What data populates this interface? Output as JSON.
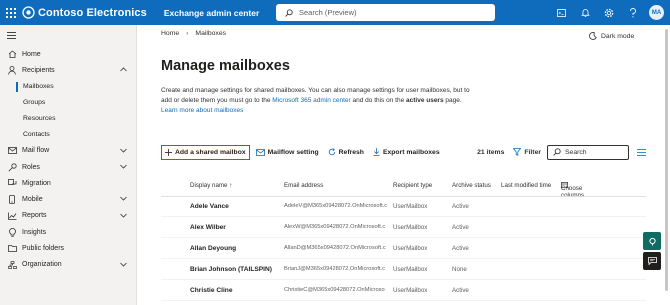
{
  "topbar": {
    "brand": "Contoso Electronics",
    "app_name": "Exchange admin center",
    "search_placeholder": "Search (Preview)",
    "user_initials": "MA",
    "icons": [
      "waffle-icon",
      "terminal-icon",
      "notifications-icon",
      "settings-icon",
      "help-icon"
    ],
    "color": "#0f6cbd"
  },
  "sidebar": {
    "items": [
      {
        "label": "Home",
        "icon": "home-icon"
      },
      {
        "label": "Recipients",
        "icon": "person-icon",
        "expanded": true,
        "children": [
          {
            "label": "Mailboxes",
            "active": true
          },
          {
            "label": "Groups"
          },
          {
            "label": "Resources"
          },
          {
            "label": "Contacts"
          }
        ]
      },
      {
        "label": "Mail flow",
        "icon": "mail-icon"
      },
      {
        "label": "Roles",
        "icon": "key-icon"
      },
      {
        "label": "Migration",
        "icon": "migration-icon"
      },
      {
        "label": "Mobile",
        "icon": "mobile-icon"
      },
      {
        "label": "Reports",
        "icon": "chart-icon"
      },
      {
        "label": "Insights",
        "icon": "lightbulb-icon"
      },
      {
        "label": "Public folders",
        "icon": "folder-icon"
      },
      {
        "label": "Organization",
        "icon": "organization-icon"
      }
    ]
  },
  "main": {
    "breadcrumb": [
      "Home",
      "Mailboxes"
    ],
    "dark_mode_label": "Dark mode",
    "title": "Manage mailboxes",
    "description": {
      "part1": "Create and manage settings for shared mailboxes. You can also manage settings for user mailboxes, but to add or delete them you must go to the ",
      "link1": "Microsoft 365 admin center",
      "part2": " and do this on the ",
      "bold": "active users",
      "part3": " page. ",
      "link2": "Learn more about mailboxes"
    },
    "toolbar": {
      "add_shared": "Add a shared mailbox",
      "mailflow": "Mailflow setting",
      "refresh": "Refresh",
      "export": "Export mailboxes",
      "count": "21 items",
      "filter": "Filter",
      "search_placeholder": "Search"
    },
    "table": {
      "headers": {
        "display_name": "Display name ↑",
        "email": "Email address",
        "recipient_type": "Recipient type",
        "archive_status": "Archive status",
        "last_modified": "Last modified time",
        "choose_columns": "Choose columns"
      },
      "rows": [
        {
          "name": "Adele Vance",
          "email": "AdeleV@M365x09428072.OnMicrosoft.c",
          "type": "UserMailbox",
          "status": "Active"
        },
        {
          "name": "Alex Wilber",
          "email": "AlexW@M365x09428072.OnMicrosoft.c",
          "type": "UserMailbox",
          "status": "Active"
        },
        {
          "name": "Allan Deyoung",
          "email": "AllanD@M365x09428072.OnMicrosoft.c",
          "type": "UserMailbox",
          "status": "Active"
        },
        {
          "name": "Brian Johnson (TAILSPIN)",
          "email": "BrianJ@M365x09428072.OnMicrosoft.c",
          "type": "UserMailbox",
          "status": "None"
        },
        {
          "name": "Christie Cline",
          "email": "ChristieC@M365x09428072.OnMicroso",
          "type": "UserMailbox",
          "status": "Active"
        }
      ]
    }
  }
}
